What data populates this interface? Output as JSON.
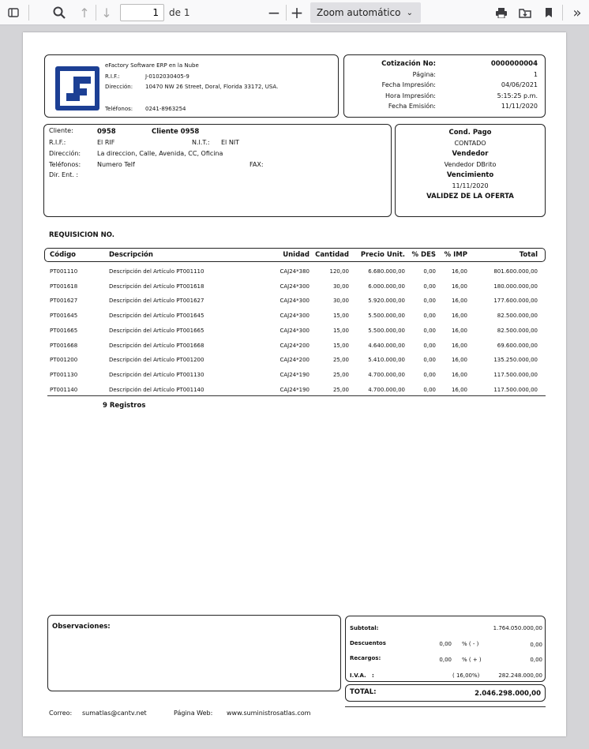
{
  "toolbar": {
    "page_current": "1",
    "page_total": "de 1",
    "zoom": "Zoom automático"
  },
  "company": {
    "name": "eFactory Software ERP en la Nube",
    "rif_label": "R.I.F.:",
    "rif": "J-0102030405-9",
    "address_label": "Dirección:",
    "address": "10470 NW 26 Street, Doral, Florida 33172, USA.",
    "phone_label": "Teléfonos:",
    "phone": "0241-8963254"
  },
  "quote": {
    "number_label": "Cotización No:",
    "number": "0000000004",
    "page_label": "Página:",
    "page": "1",
    "print_date_label": "Fecha Impresión:",
    "print_date": "04/06/2021",
    "print_time_label": "Hora Impresión:",
    "print_time": "5:15:25 p.m.",
    "issue_date_label": "Fecha Emisión:",
    "issue_date": "11/11/2020"
  },
  "client": {
    "client_label": "Cliente:",
    "code": "0958",
    "name": "Cliente 0958",
    "rif_label": "R.I.F.:",
    "rif": "El RIF",
    "nit_label": "N.I.T.:",
    "nit": "El NIT",
    "address_label": "Dirección:",
    "address": "La direccion, Calle, Avenida, CC, Oficina",
    "phone_label": "Teléfonos:",
    "phone": "Numero Telf",
    "fax_label": "FAX:",
    "delivery_label": "Dir. Ent. :"
  },
  "terms": {
    "payment_label": "Cond. Pago",
    "payment": "CONTADO",
    "seller_label": "Vendedor",
    "seller": "Vendedor DBrito",
    "due_label": "Vencimiento",
    "due": "11/11/2020",
    "validity_label": "VALIDEZ DE LA OFERTA"
  },
  "requisition_label": "REQUISICION NO.",
  "table": {
    "headers": [
      "Código",
      "Descripción",
      "Unidad",
      "Cantidad",
      "Precio Unit.",
      "% DES",
      "% IMP",
      "Total"
    ],
    "rows": [
      [
        "PT001110",
        "Descripción del Artículo PT001110",
        "CAJ24*380",
        "120,00",
        "6.680.000,00",
        "0,00",
        "16,00",
        "801.600.000,00"
      ],
      [
        "PT001618",
        "Descripción del Artículo PT001618",
        "CAJ24*300",
        "30,00",
        "6.000.000,00",
        "0,00",
        "16,00",
        "180.000.000,00"
      ],
      [
        "PT001627",
        "Descripción del Artículo PT001627",
        "CAJ24*300",
        "30,00",
        "5.920.000,00",
        "0,00",
        "16,00",
        "177.600.000,00"
      ],
      [
        "PT001645",
        "Descripción del Artículo PT001645",
        "CAJ24*300",
        "15,00",
        "5.500.000,00",
        "0,00",
        "16,00",
        "82.500.000,00"
      ],
      [
        "PT001665",
        "Descripción del Artículo PT001665",
        "CAJ24*300",
        "15,00",
        "5.500.000,00",
        "0,00",
        "16,00",
        "82.500.000,00"
      ],
      [
        "PT001668",
        "Descripción del Artículo PT001668",
        "CAJ24*200",
        "15,00",
        "4.640.000,00",
        "0,00",
        "16,00",
        "69.600.000,00"
      ],
      [
        "PT001200",
        "Descripción del Artículo PT001200",
        "CAJ24*200",
        "25,00",
        "5.410.000,00",
        "0,00",
        "16,00",
        "135.250.000,00"
      ],
      [
        "PT001130",
        "Descripción del Artículo PT001130",
        "CAJ24*190",
        "25,00",
        "4.700.000,00",
        "0,00",
        "16,00",
        "117.500.000,00"
      ],
      [
        "PT001140",
        "Descripción del Artículo PT001140",
        "CAJ24*190",
        "25,00",
        "4.700.000,00",
        "0,00",
        "16,00",
        "117.500.000,00"
      ]
    ],
    "records": "9 Registros"
  },
  "observations_label": "Observaciones:",
  "totals": {
    "subtotal_label": "Subtotal:",
    "subtotal": "1.764.050.000,00",
    "discount_label": "Descuentos",
    "discount_pct": "0,00",
    "discount_sign": "% ( - )",
    "discount": "0,00",
    "surcharge_label": "Recargos:",
    "surcharge_pct": "0,00",
    "surcharge_sign": "% ( + )",
    "surcharge": "0,00",
    "iva_label": "I.V.A.   :",
    "iva_pct": "( 16,00%)",
    "iva": "282.248.000,00",
    "total_label": "TOTAL:",
    "total": "2.046.298.000,00"
  },
  "footer": {
    "email_label": "Correo:",
    "email": "sumatlas@cantv.net",
    "web_label": "Página Web:",
    "web": "www.suministrosatlas.com"
  }
}
